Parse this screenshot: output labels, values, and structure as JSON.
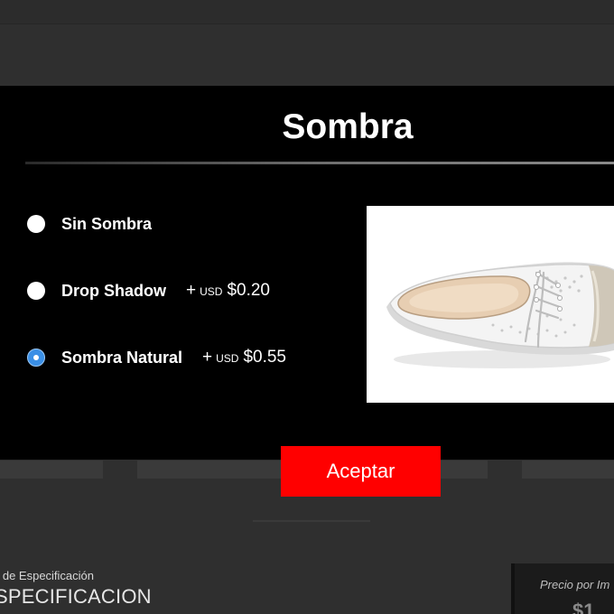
{
  "modal": {
    "title": "Sombra",
    "options": [
      {
        "label": "Sin Sombra",
        "price_prefix": "",
        "currency": "",
        "price": "",
        "selected": false
      },
      {
        "label": "Drop Shadow",
        "price_prefix": "+",
        "currency": "USD",
        "price": "$0.20",
        "selected": false
      },
      {
        "label": "Sombra Natural",
        "price_prefix": "+",
        "currency": "USD",
        "price": "$0.55",
        "selected": true
      }
    ],
    "preview_image": "white perforated lace-up shoe",
    "accept_label": "Aceptar"
  },
  "background": {
    "spec_caption": "e de Especificación",
    "spec_title": "SPECIFICACION",
    "price_label": "Precio por Im",
    "price_value": "$1"
  },
  "colors": {
    "accent_button": "#ff0000",
    "radio_selected": "#3a8fe6",
    "modal_bg": "#000000"
  }
}
